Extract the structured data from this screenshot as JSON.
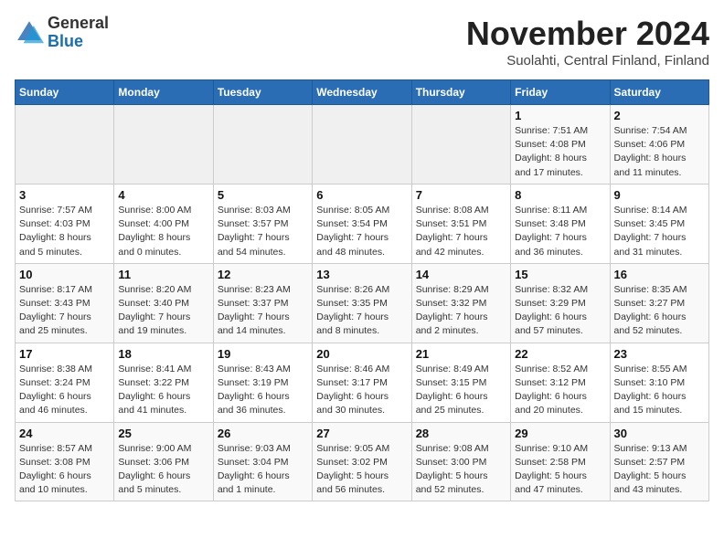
{
  "header": {
    "logo_line1": "General",
    "logo_line2": "Blue",
    "month_title": "November 2024",
    "subtitle": "Suolahti, Central Finland, Finland"
  },
  "weekdays": [
    "Sunday",
    "Monday",
    "Tuesday",
    "Wednesday",
    "Thursday",
    "Friday",
    "Saturday"
  ],
  "weeks": [
    [
      {
        "day": "",
        "info": ""
      },
      {
        "day": "",
        "info": ""
      },
      {
        "day": "",
        "info": ""
      },
      {
        "day": "",
        "info": ""
      },
      {
        "day": "",
        "info": ""
      },
      {
        "day": "1",
        "info": "Sunrise: 7:51 AM\nSunset: 4:08 PM\nDaylight: 8 hours\nand 17 minutes."
      },
      {
        "day": "2",
        "info": "Sunrise: 7:54 AM\nSunset: 4:06 PM\nDaylight: 8 hours\nand 11 minutes."
      }
    ],
    [
      {
        "day": "3",
        "info": "Sunrise: 7:57 AM\nSunset: 4:03 PM\nDaylight: 8 hours\nand 5 minutes."
      },
      {
        "day": "4",
        "info": "Sunrise: 8:00 AM\nSunset: 4:00 PM\nDaylight: 8 hours\nand 0 minutes."
      },
      {
        "day": "5",
        "info": "Sunrise: 8:03 AM\nSunset: 3:57 PM\nDaylight: 7 hours\nand 54 minutes."
      },
      {
        "day": "6",
        "info": "Sunrise: 8:05 AM\nSunset: 3:54 PM\nDaylight: 7 hours\nand 48 minutes."
      },
      {
        "day": "7",
        "info": "Sunrise: 8:08 AM\nSunset: 3:51 PM\nDaylight: 7 hours\nand 42 minutes."
      },
      {
        "day": "8",
        "info": "Sunrise: 8:11 AM\nSunset: 3:48 PM\nDaylight: 7 hours\nand 36 minutes."
      },
      {
        "day": "9",
        "info": "Sunrise: 8:14 AM\nSunset: 3:45 PM\nDaylight: 7 hours\nand 31 minutes."
      }
    ],
    [
      {
        "day": "10",
        "info": "Sunrise: 8:17 AM\nSunset: 3:43 PM\nDaylight: 7 hours\nand 25 minutes."
      },
      {
        "day": "11",
        "info": "Sunrise: 8:20 AM\nSunset: 3:40 PM\nDaylight: 7 hours\nand 19 minutes."
      },
      {
        "day": "12",
        "info": "Sunrise: 8:23 AM\nSunset: 3:37 PM\nDaylight: 7 hours\nand 14 minutes."
      },
      {
        "day": "13",
        "info": "Sunrise: 8:26 AM\nSunset: 3:35 PM\nDaylight: 7 hours\nand 8 minutes."
      },
      {
        "day": "14",
        "info": "Sunrise: 8:29 AM\nSunset: 3:32 PM\nDaylight: 7 hours\nand 2 minutes."
      },
      {
        "day": "15",
        "info": "Sunrise: 8:32 AM\nSunset: 3:29 PM\nDaylight: 6 hours\nand 57 minutes."
      },
      {
        "day": "16",
        "info": "Sunrise: 8:35 AM\nSunset: 3:27 PM\nDaylight: 6 hours\nand 52 minutes."
      }
    ],
    [
      {
        "day": "17",
        "info": "Sunrise: 8:38 AM\nSunset: 3:24 PM\nDaylight: 6 hours\nand 46 minutes."
      },
      {
        "day": "18",
        "info": "Sunrise: 8:41 AM\nSunset: 3:22 PM\nDaylight: 6 hours\nand 41 minutes."
      },
      {
        "day": "19",
        "info": "Sunrise: 8:43 AM\nSunset: 3:19 PM\nDaylight: 6 hours\nand 36 minutes."
      },
      {
        "day": "20",
        "info": "Sunrise: 8:46 AM\nSunset: 3:17 PM\nDaylight: 6 hours\nand 30 minutes."
      },
      {
        "day": "21",
        "info": "Sunrise: 8:49 AM\nSunset: 3:15 PM\nDaylight: 6 hours\nand 25 minutes."
      },
      {
        "day": "22",
        "info": "Sunrise: 8:52 AM\nSunset: 3:12 PM\nDaylight: 6 hours\nand 20 minutes."
      },
      {
        "day": "23",
        "info": "Sunrise: 8:55 AM\nSunset: 3:10 PM\nDaylight: 6 hours\nand 15 minutes."
      }
    ],
    [
      {
        "day": "24",
        "info": "Sunrise: 8:57 AM\nSunset: 3:08 PM\nDaylight: 6 hours\nand 10 minutes."
      },
      {
        "day": "25",
        "info": "Sunrise: 9:00 AM\nSunset: 3:06 PM\nDaylight: 6 hours\nand 5 minutes."
      },
      {
        "day": "26",
        "info": "Sunrise: 9:03 AM\nSunset: 3:04 PM\nDaylight: 6 hours\nand 1 minute."
      },
      {
        "day": "27",
        "info": "Sunrise: 9:05 AM\nSunset: 3:02 PM\nDaylight: 5 hours\nand 56 minutes."
      },
      {
        "day": "28",
        "info": "Sunrise: 9:08 AM\nSunset: 3:00 PM\nDaylight: 5 hours\nand 52 minutes."
      },
      {
        "day": "29",
        "info": "Sunrise: 9:10 AM\nSunset: 2:58 PM\nDaylight: 5 hours\nand 47 minutes."
      },
      {
        "day": "30",
        "info": "Sunrise: 9:13 AM\nSunset: 2:57 PM\nDaylight: 5 hours\nand 43 minutes."
      }
    ]
  ]
}
